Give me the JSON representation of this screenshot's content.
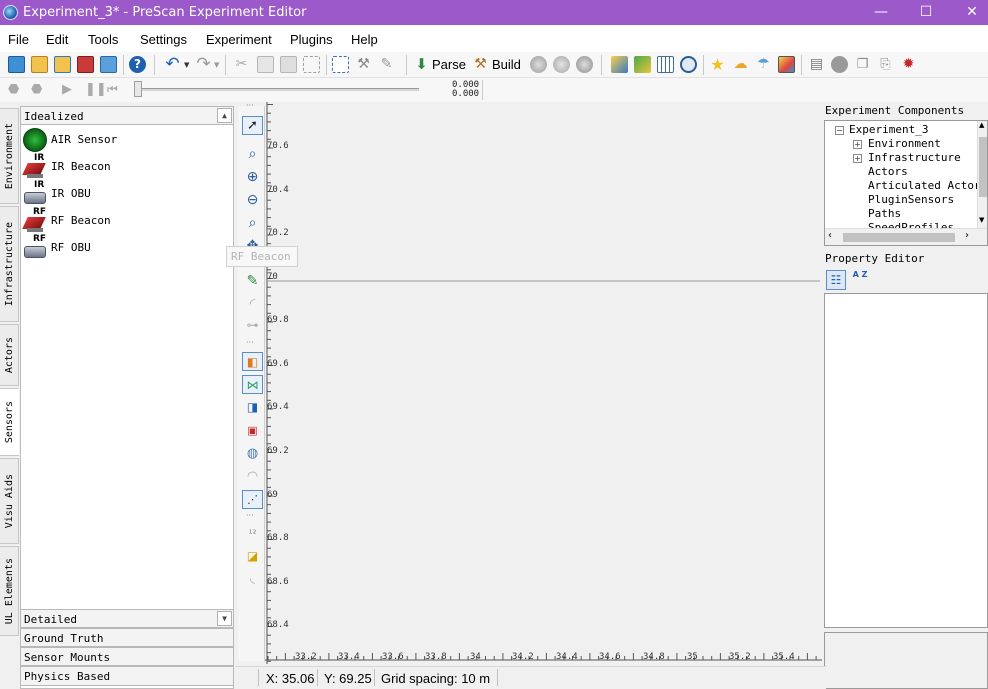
{
  "window": {
    "title": "Experiment_3* - PreScan Experiment Editor",
    "controls": {
      "minimize": "—",
      "maximize": "☐",
      "close": "✕"
    }
  },
  "menu": [
    "File",
    "Edit",
    "Tools",
    "Settings",
    "Experiment",
    "Plugins",
    "Help"
  ],
  "toolbar": {
    "parse_label": "Parse",
    "build_label": "Build"
  },
  "toolbar2": {
    "coord_x": "0.000",
    "coord_y": "0.000"
  },
  "left_tabs": [
    "Environment",
    "Infrastructure",
    "Actors",
    "Sensors",
    "Visu Aids",
    "UL Elements"
  ],
  "active_left_tab": "Sensors",
  "palette": {
    "idealized_header": "Idealized",
    "items": [
      {
        "label": "AIR Sensor",
        "icon": "air-sensor-icon"
      },
      {
        "label": "IR Beacon",
        "icon": "ir-beacon-icon",
        "badge": "IR"
      },
      {
        "label": "IR OBU",
        "icon": "ir-obu-icon",
        "badge": "IR"
      },
      {
        "label": "RF Beacon",
        "icon": "rf-beacon-icon",
        "badge": "RF"
      },
      {
        "label": "RF OBU",
        "icon": "rf-obu-icon",
        "badge": "RF"
      }
    ],
    "groups": [
      "Detailed",
      "Ground Truth",
      "Sensor Mounts",
      "Physics Based"
    ]
  },
  "tooltip": "RF Beacon",
  "canvas": {
    "y_labels": [
      "70.6",
      "70.4",
      "70.2",
      "70",
      "69.8",
      "69.6",
      "69.4",
      "69.2",
      "69",
      "68.8",
      "68.6",
      "68.4"
    ],
    "x_labels": [
      "33.2",
      "33.4",
      "33.6",
      "33.8",
      "34",
      "34.2",
      "34.4",
      "34.6",
      "34.8",
      "35",
      "35.2",
      "35.4"
    ]
  },
  "components": {
    "title": "Experiment Components",
    "root": "Experiment_3",
    "children": [
      {
        "label": "Environment",
        "expandable": true
      },
      {
        "label": "Infrastructure",
        "expandable": true
      },
      {
        "label": "Actors",
        "expandable": false
      },
      {
        "label": "Articulated Actors",
        "expandable": false
      },
      {
        "label": "PluginSensors",
        "expandable": false
      },
      {
        "label": "Paths",
        "expandable": false
      },
      {
        "label": "SpeedProfiles",
        "expandable": false
      }
    ]
  },
  "property_editor": {
    "title": "Property Editor",
    "sort_alpha_label": "A Z"
  },
  "status": {
    "x": "X: 35.06",
    "y": "Y: 69.25",
    "grid": "Grid spacing: 10 m"
  },
  "colors": {
    "titlebar": "#9b59c9",
    "accent": "#2b6fb5"
  }
}
